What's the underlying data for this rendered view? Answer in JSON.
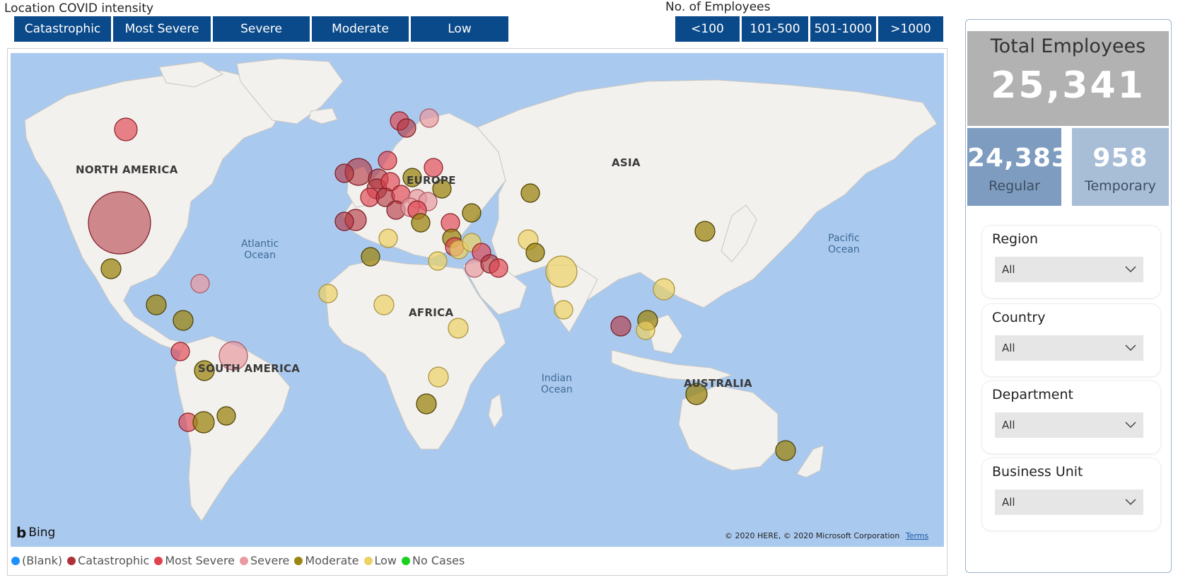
{
  "slicers": {
    "intensity": {
      "title": "Location COVID intensity",
      "buttons": [
        "Catastrophic",
        "Most Severe",
        "Severe",
        "Moderate",
        "Low"
      ]
    },
    "employees": {
      "title": "No. of Employees",
      "buttons": [
        "<100",
        "101-500",
        "501-1000",
        ">1000"
      ]
    }
  },
  "map": {
    "continent_labels": [
      "NORTH AMERICA",
      "EUROPE",
      "ASIA",
      "AFRICA",
      "SOUTH AMERICA",
      "AUSTRALIA"
    ],
    "ocean_labels": [
      "Atlantic\nOcean",
      "Pacific\nOcean",
      "Indian\nOcean"
    ],
    "bing_label": "Bing",
    "copyright": "© 2020 HERE, © 2020 Microsoft Corporation",
    "terms_label": "Terms"
  },
  "legend": [
    {
      "label": "(Blank)",
      "color": "#1e90ff"
    },
    {
      "label": "Catastrophic",
      "color": "#b0303a"
    },
    {
      "label": "Most Severe",
      "color": "#e0434f"
    },
    {
      "label": "Severe",
      "color": "#e89aa0"
    },
    {
      "label": "Moderate",
      "color": "#9c8613"
    },
    {
      "label": "Low",
      "color": "#ecd264"
    },
    {
      "label": "No Cases",
      "color": "#19d11e"
    }
  ],
  "kpi": {
    "total_title": "Total Employees",
    "total_value": "25,341",
    "regular_value": "24,383",
    "regular_label": "Regular",
    "temporary_value": "958",
    "temporary_label": "Temporary"
  },
  "filters": [
    {
      "title": "Region",
      "value": "All"
    },
    {
      "title": "Country",
      "value": "All"
    },
    {
      "title": "Department",
      "value": "All"
    },
    {
      "title": "Business Unit",
      "value": "All"
    }
  ]
}
